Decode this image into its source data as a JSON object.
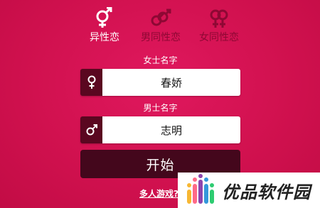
{
  "tabs": [
    {
      "label": "异性恋",
      "icon": "hetero-symbol-icon",
      "active": true
    },
    {
      "label": "男同性恋",
      "icon": "male-male-symbol-icon",
      "active": false
    },
    {
      "label": "女同性恋",
      "icon": "female-female-symbol-icon",
      "active": false
    }
  ],
  "female": {
    "label": "女士名字",
    "value": "春娇",
    "icon": "female-symbol-icon"
  },
  "male": {
    "label": "男士名字",
    "value": "志明",
    "icon": "male-symbol-icon"
  },
  "start_label": "开始",
  "multiplayer_label": "多人游戏?",
  "watermark": {
    "text": "优品软件园"
  },
  "colors": {
    "background": "#d1114f",
    "icon_box": "#5a0720",
    "button": "#44071c",
    "inactive_tab": "#8e0834"
  }
}
